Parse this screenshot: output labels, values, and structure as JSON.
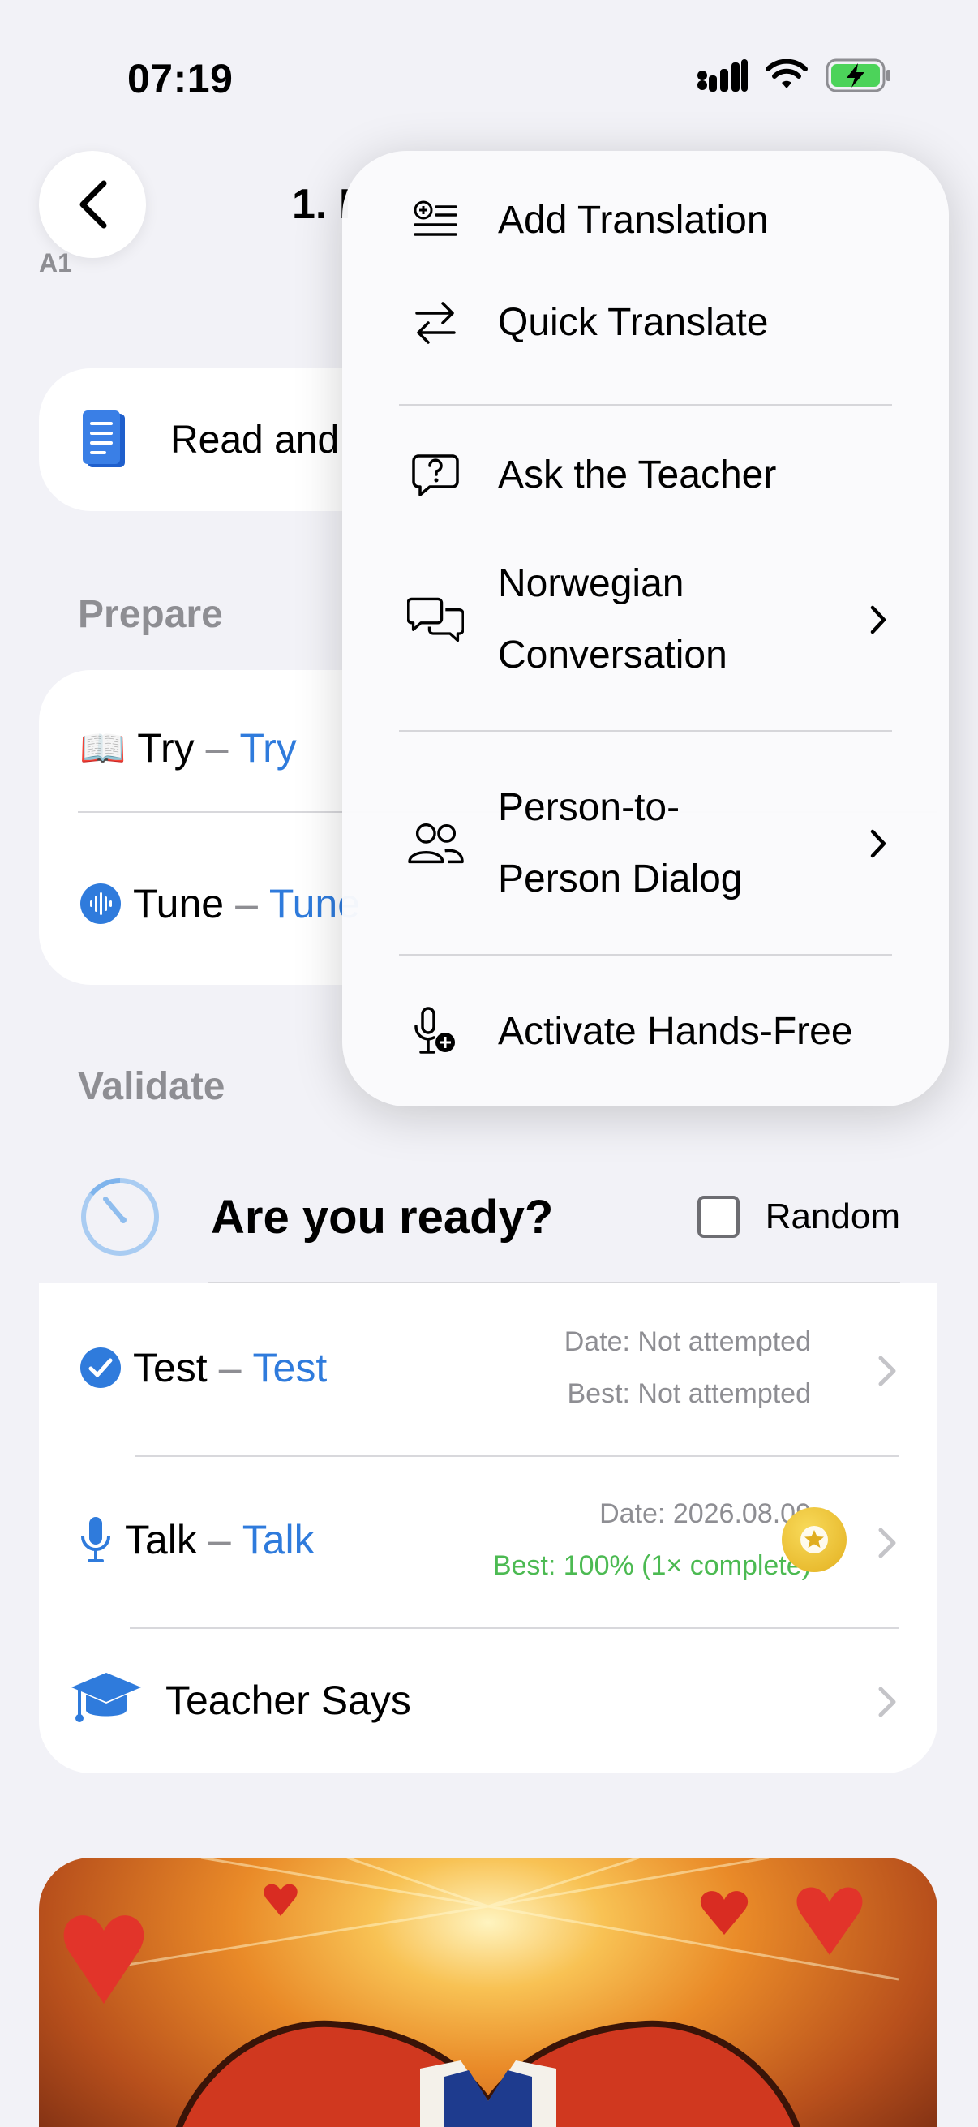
{
  "status_bar": {
    "time": "07:19"
  },
  "header": {
    "level": "A1",
    "title": "1. I"
  },
  "read_card": {
    "label": "Read and"
  },
  "prepare": {
    "title": "Prepare",
    "rows": [
      {
        "emoji": "📖",
        "label": "Try",
        "translation": "Try"
      },
      {
        "label": "Tune",
        "translation": "Tune"
      }
    ]
  },
  "validate": {
    "title": "Validate",
    "ready_label": "Are you ready?",
    "random_label": "Random",
    "rows": [
      {
        "label": "Test",
        "translation": "Test",
        "date": "Date: Not attempted",
        "best": "Best: Not attempted"
      },
      {
        "label": "Talk",
        "translation": "Talk",
        "date": "Date: 2026.08.09",
        "best": "Best: 100% (1× complete)"
      },
      {
        "label": "Teacher Says"
      }
    ]
  },
  "menu": {
    "items": [
      {
        "label": "Add Translation",
        "icon": "add-list-icon"
      },
      {
        "label": "Quick Translate",
        "icon": "swap-arrows-icon"
      },
      {
        "label": "Ask the Teacher",
        "icon": "question-bubble-icon"
      },
      {
        "label_line1": "Norwegian",
        "label_line2": "Conversation",
        "icon": "chat-bubbles-icon"
      },
      {
        "label_line1": "Person-to-",
        "label_line2": "Person Dialog",
        "icon": "people-icon"
      },
      {
        "label": "Activate Hands-Free",
        "icon": "mic-plus-icon"
      }
    ]
  },
  "colors": {
    "accent": "#2f7bdc",
    "success": "#4cba52",
    "background": "#f2f2f7"
  }
}
